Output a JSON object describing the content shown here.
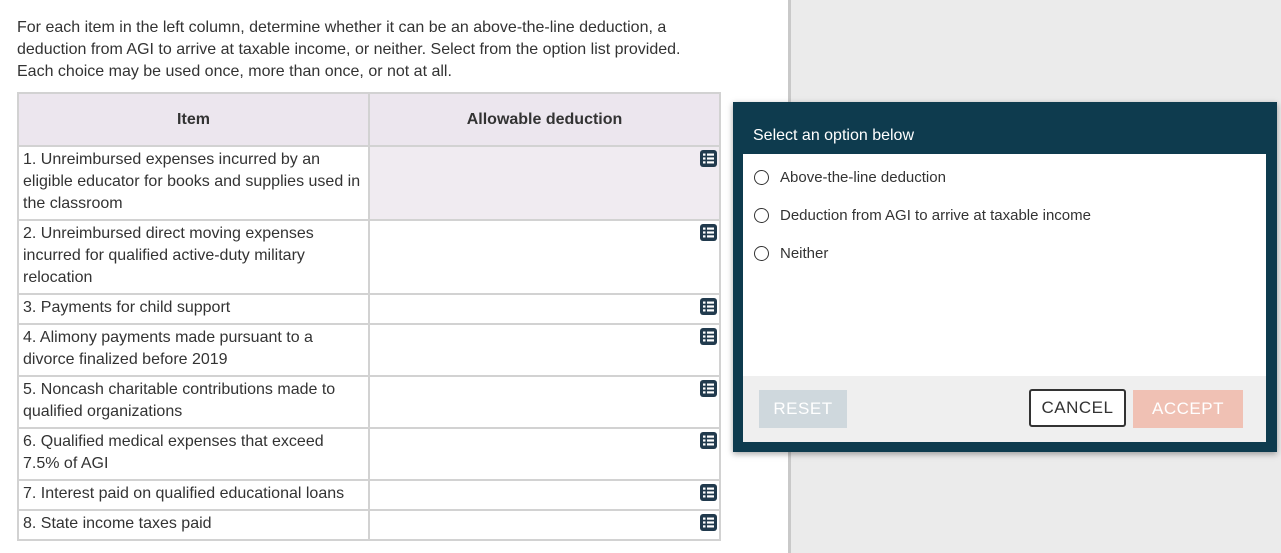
{
  "instructions": "For each item in the left column, determine whether it can be an above-the-line deduction, a deduction from AGI to arrive at taxable income, or neither. Select from the option list provided. Each choice may be used once, more than once, or not at all.",
  "table": {
    "headers": {
      "item": "Item",
      "deduction": "Allowable deduction"
    },
    "rows": [
      {
        "label": "1. Unreimbursed expenses incurred by an eligible educator for books and supplies used in the classroom",
        "value": ""
      },
      {
        "label": "2. Unreimbursed direct moving expenses incurred for qualified active-duty military relocation",
        "value": ""
      },
      {
        "label": "3. Payments for child support",
        "value": ""
      },
      {
        "label": "4. Alimony payments made pursuant to a divorce finalized before 2019",
        "value": ""
      },
      {
        "label": "5. Noncash charitable contributions made to qualified organizations",
        "value": ""
      },
      {
        "label": "6. Qualified medical expenses that exceed 7.5% of AGI",
        "value": ""
      },
      {
        "label": "7. Interest paid on qualified educational loans",
        "value": ""
      },
      {
        "label": "8. State income taxes paid",
        "value": ""
      }
    ]
  },
  "modal": {
    "title": "Select an option below",
    "options": [
      "Above-the-line deduction",
      "Deduction from AGI to arrive at taxable income",
      "Neither"
    ],
    "buttons": {
      "reset": "RESET",
      "cancel": "CANCEL",
      "accept": "ACCEPT"
    }
  },
  "colors": {
    "modal_bg": "#0e3b4e",
    "header_bg": "#ece6ee",
    "accept_disabled": "#f0c1b4",
    "reset_disabled": "#cfd8dd",
    "list_icon": "#213a4d"
  }
}
